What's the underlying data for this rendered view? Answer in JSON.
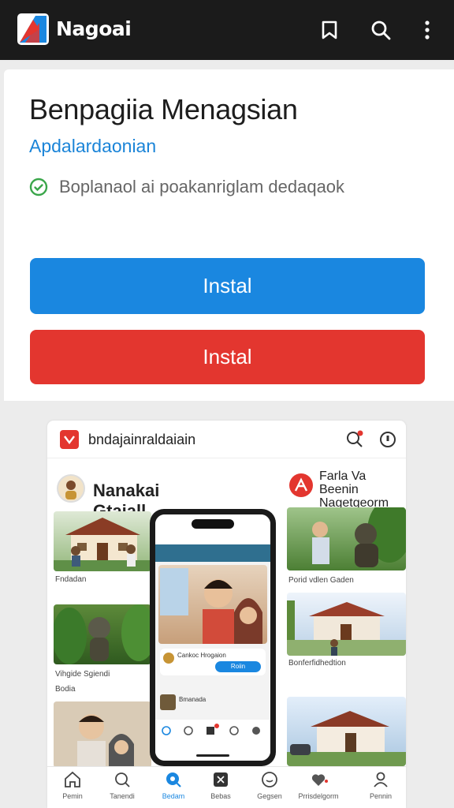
{
  "app": {
    "name": "Nagoai",
    "accent": "#1a87e0",
    "danger": "#e3362f"
  },
  "topbar_icons": [
    "bookmark-icon",
    "search-icon",
    "more-vert-icon"
  ],
  "card": {
    "title": "Benpagiia Menagsian",
    "subtitle": "Apdalardaonian",
    "status_text": "Boplanaol ai poakanriglam dedaqaok",
    "install_primary": "Instal",
    "install_secondary": "Instal"
  },
  "preview": {
    "header_title": "bndajainraldaiain",
    "feature_title": "Nanakai Gtajall",
    "right_title_line1": "Farla Va Beenin",
    "right_title_line2": "Nagetgeorm",
    "captions": {
      "left1": "Fndadan",
      "left2": "Vihgide Sgiendi",
      "left3": "Bodia",
      "right1": "Porid vdlen Gaden",
      "right2": "Bonferfidhedtion"
    },
    "phone": {
      "chip": "Cankoc Hrogaion",
      "chip_button": "Roiin",
      "list_text": "Bmanada"
    },
    "nav": [
      {
        "label": "Pemin",
        "icon": "home-icon"
      },
      {
        "label": "Tanendi",
        "icon": "search-icon"
      },
      {
        "label": "Bedam",
        "icon": "discover-icon"
      },
      {
        "label": "Bebas",
        "icon": "grid-icon"
      },
      {
        "label": "Gegsen",
        "icon": "smile-icon"
      },
      {
        "label": "Prrisdelgorm",
        "icon": "heart-icon"
      },
      {
        "label": "Pennin",
        "icon": "profile-icon"
      }
    ]
  }
}
